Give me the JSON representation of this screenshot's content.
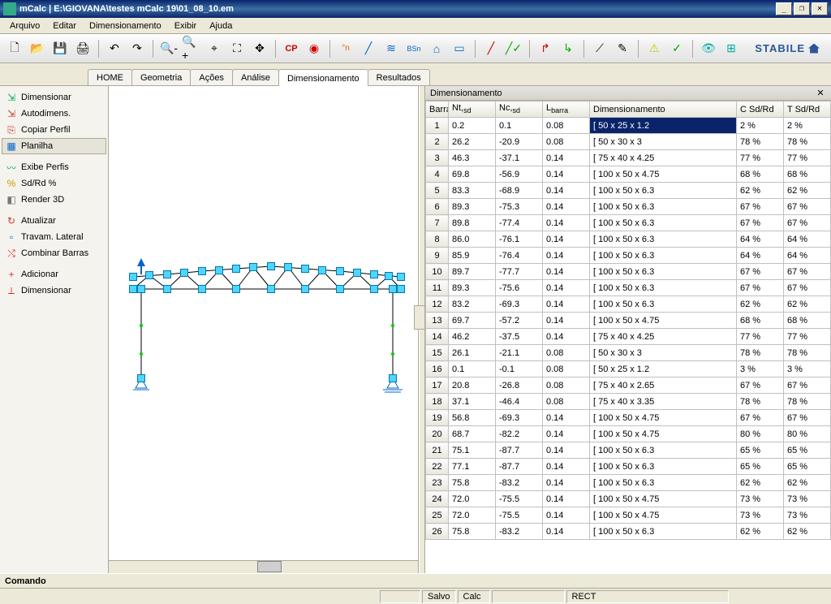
{
  "window": {
    "title": "mCalc  |  E:\\GIOVANA\\testes mCalc 19\\01_08_10.em"
  },
  "menubar": [
    "Arquivo",
    "Editar",
    "Dimensionamento",
    "Exibir",
    "Ajuda"
  ],
  "brand": "STABILE",
  "tabs": [
    "HOME",
    "Geometria",
    "Ações",
    "Análise",
    "Dimensionamento",
    "Resultados"
  ],
  "tabs_active": 4,
  "sidebar": {
    "g1": [
      {
        "icon": "⇲",
        "color": "#0a5",
        "label": "Dimensionar"
      },
      {
        "icon": "⇲",
        "color": "#c33",
        "label": "Autodimens."
      },
      {
        "icon": "⎘",
        "color": "#c33",
        "label": "Copiar Perfil"
      },
      {
        "icon": "▦",
        "color": "#06c",
        "label": "Planilha",
        "active": true
      }
    ],
    "g2": [
      {
        "icon": "〰",
        "color": "#0a5",
        "label": "Exibe Perfis"
      },
      {
        "icon": "%",
        "color": "#c90",
        "label": "Sd/Rd %"
      },
      {
        "icon": "◧",
        "color": "#777",
        "label": "Render 3D"
      }
    ],
    "g3": [
      {
        "icon": "↻",
        "color": "#c33",
        "label": "Atualizar"
      },
      {
        "icon": "▫",
        "color": "#06c",
        "label": "Travam. Lateral"
      },
      {
        "icon": "⤭",
        "color": "#c33",
        "label": "Combinar Barras"
      }
    ],
    "g4": [
      {
        "icon": "+",
        "color": "#c33",
        "label": "Adicionar"
      },
      {
        "icon": "⟂",
        "color": "#c33",
        "label": "Dimensionar"
      }
    ]
  },
  "panel_title": "Dimensionamento",
  "columns": [
    "Barra",
    "Nt,sd",
    "Nc,sd",
    "Lbarra",
    "Dimensionamento",
    "C Sd/Rd",
    "T Sd/Rd"
  ],
  "rows": [
    {
      "b": "1",
      "nt": "0.2",
      "nc": "0.1",
      "lb": "0.08",
      "dim": "[ 50 x 25 x 1.2",
      "c": "2 %",
      "t": "2 %",
      "sel": true
    },
    {
      "b": "2",
      "nt": "26.2",
      "nc": "-20.9",
      "lb": "0.08",
      "dim": "[ 50 x 30 x 3",
      "c": "78 %",
      "t": "78 %"
    },
    {
      "b": "3",
      "nt": "46.3",
      "nc": "-37.1",
      "lb": "0.14",
      "dim": "[ 75 x 40 x 4.25",
      "c": "77 %",
      "t": "77 %"
    },
    {
      "b": "4",
      "nt": "69.8",
      "nc": "-56.9",
      "lb": "0.14",
      "dim": "[ 100 x 50 x 4.75",
      "c": "68 %",
      "t": "68 %"
    },
    {
      "b": "5",
      "nt": "83.3",
      "nc": "-68.9",
      "lb": "0.14",
      "dim": "[ 100 x 50 x 6.3",
      "c": "62 %",
      "t": "62 %"
    },
    {
      "b": "6",
      "nt": "89.3",
      "nc": "-75.3",
      "lb": "0.14",
      "dim": "[ 100 x 50 x 6.3",
      "c": "67 %",
      "t": "67 %"
    },
    {
      "b": "7",
      "nt": "89.8",
      "nc": "-77.4",
      "lb": "0.14",
      "dim": "[ 100 x 50 x 6.3",
      "c": "67 %",
      "t": "67 %"
    },
    {
      "b": "8",
      "nt": "86.0",
      "nc": "-76.1",
      "lb": "0.14",
      "dim": "[ 100 x 50 x 6.3",
      "c": "64 %",
      "t": "64 %"
    },
    {
      "b": "9",
      "nt": "85.9",
      "nc": "-76.4",
      "lb": "0.14",
      "dim": "[ 100 x 50 x 6.3",
      "c": "64 %",
      "t": "64 %"
    },
    {
      "b": "10",
      "nt": "89.7",
      "nc": "-77.7",
      "lb": "0.14",
      "dim": "[ 100 x 50 x 6.3",
      "c": "67 %",
      "t": "67 %"
    },
    {
      "b": "11",
      "nt": "89.3",
      "nc": "-75.6",
      "lb": "0.14",
      "dim": "[ 100 x 50 x 6.3",
      "c": "67 %",
      "t": "67 %"
    },
    {
      "b": "12",
      "nt": "83.2",
      "nc": "-69.3",
      "lb": "0.14",
      "dim": "[ 100 x 50 x 6.3",
      "c": "62 %",
      "t": "62 %"
    },
    {
      "b": "13",
      "nt": "69.7",
      "nc": "-57.2",
      "lb": "0.14",
      "dim": "[ 100 x 50 x 4.75",
      "c": "68 %",
      "t": "68 %"
    },
    {
      "b": "14",
      "nt": "46.2",
      "nc": "-37.5",
      "lb": "0.14",
      "dim": "[ 75 x 40 x 4.25",
      "c": "77 %",
      "t": "77 %"
    },
    {
      "b": "15",
      "nt": "26.1",
      "nc": "-21.1",
      "lb": "0.08",
      "dim": "[ 50 x 30 x 3",
      "c": "78 %",
      "t": "78 %"
    },
    {
      "b": "16",
      "nt": "0.1",
      "nc": "-0.1",
      "lb": "0.08",
      "dim": "[ 50 x 25 x 1.2",
      "c": "3 %",
      "t": "3 %"
    },
    {
      "b": "17",
      "nt": "20.8",
      "nc": "-26.8",
      "lb": "0.08",
      "dim": "[ 75 x 40 x 2.65",
      "c": "67 %",
      "t": "67 %"
    },
    {
      "b": "18",
      "nt": "37.1",
      "nc": "-46.4",
      "lb": "0.08",
      "dim": "[ 75 x 40 x 3.35",
      "c": "78 %",
      "t": "78 %"
    },
    {
      "b": "19",
      "nt": "56.8",
      "nc": "-69.3",
      "lb": "0.14",
      "dim": "[ 100 x 50 x 4.75",
      "c": "67 %",
      "t": "67 %"
    },
    {
      "b": "20",
      "nt": "68.7",
      "nc": "-82.2",
      "lb": "0.14",
      "dim": "[ 100 x 50 x 4.75",
      "c": "80 %",
      "t": "80 %"
    },
    {
      "b": "21",
      "nt": "75.1",
      "nc": "-87.7",
      "lb": "0.14",
      "dim": "[ 100 x 50 x 6.3",
      "c": "65 %",
      "t": "65 %"
    },
    {
      "b": "22",
      "nt": "77.1",
      "nc": "-87.7",
      "lb": "0.14",
      "dim": "[ 100 x 50 x 6.3",
      "c": "65 %",
      "t": "65 %"
    },
    {
      "b": "23",
      "nt": "75.8",
      "nc": "-83.2",
      "lb": "0.14",
      "dim": "[ 100 x 50 x 6.3",
      "c": "62 %",
      "t": "62 %"
    },
    {
      "b": "24",
      "nt": "72.0",
      "nc": "-75.5",
      "lb": "0.14",
      "dim": "[ 100 x 50 x 4.75",
      "c": "73 %",
      "t": "73 %"
    },
    {
      "b": "25",
      "nt": "72.0",
      "nc": "-75.5",
      "lb": "0.14",
      "dim": "[ 100 x 50 x 4.75",
      "c": "73 %",
      "t": "73 %"
    },
    {
      "b": "26",
      "nt": "75.8",
      "nc": "-83.2",
      "lb": "0.14",
      "dim": "[ 100 x 50 x 6.3",
      "c": "62 %",
      "t": "62 %"
    }
  ],
  "status": "Comando",
  "footer": {
    "salvo": "Salvo",
    "calc": "Calc",
    "rect": "RECT"
  }
}
